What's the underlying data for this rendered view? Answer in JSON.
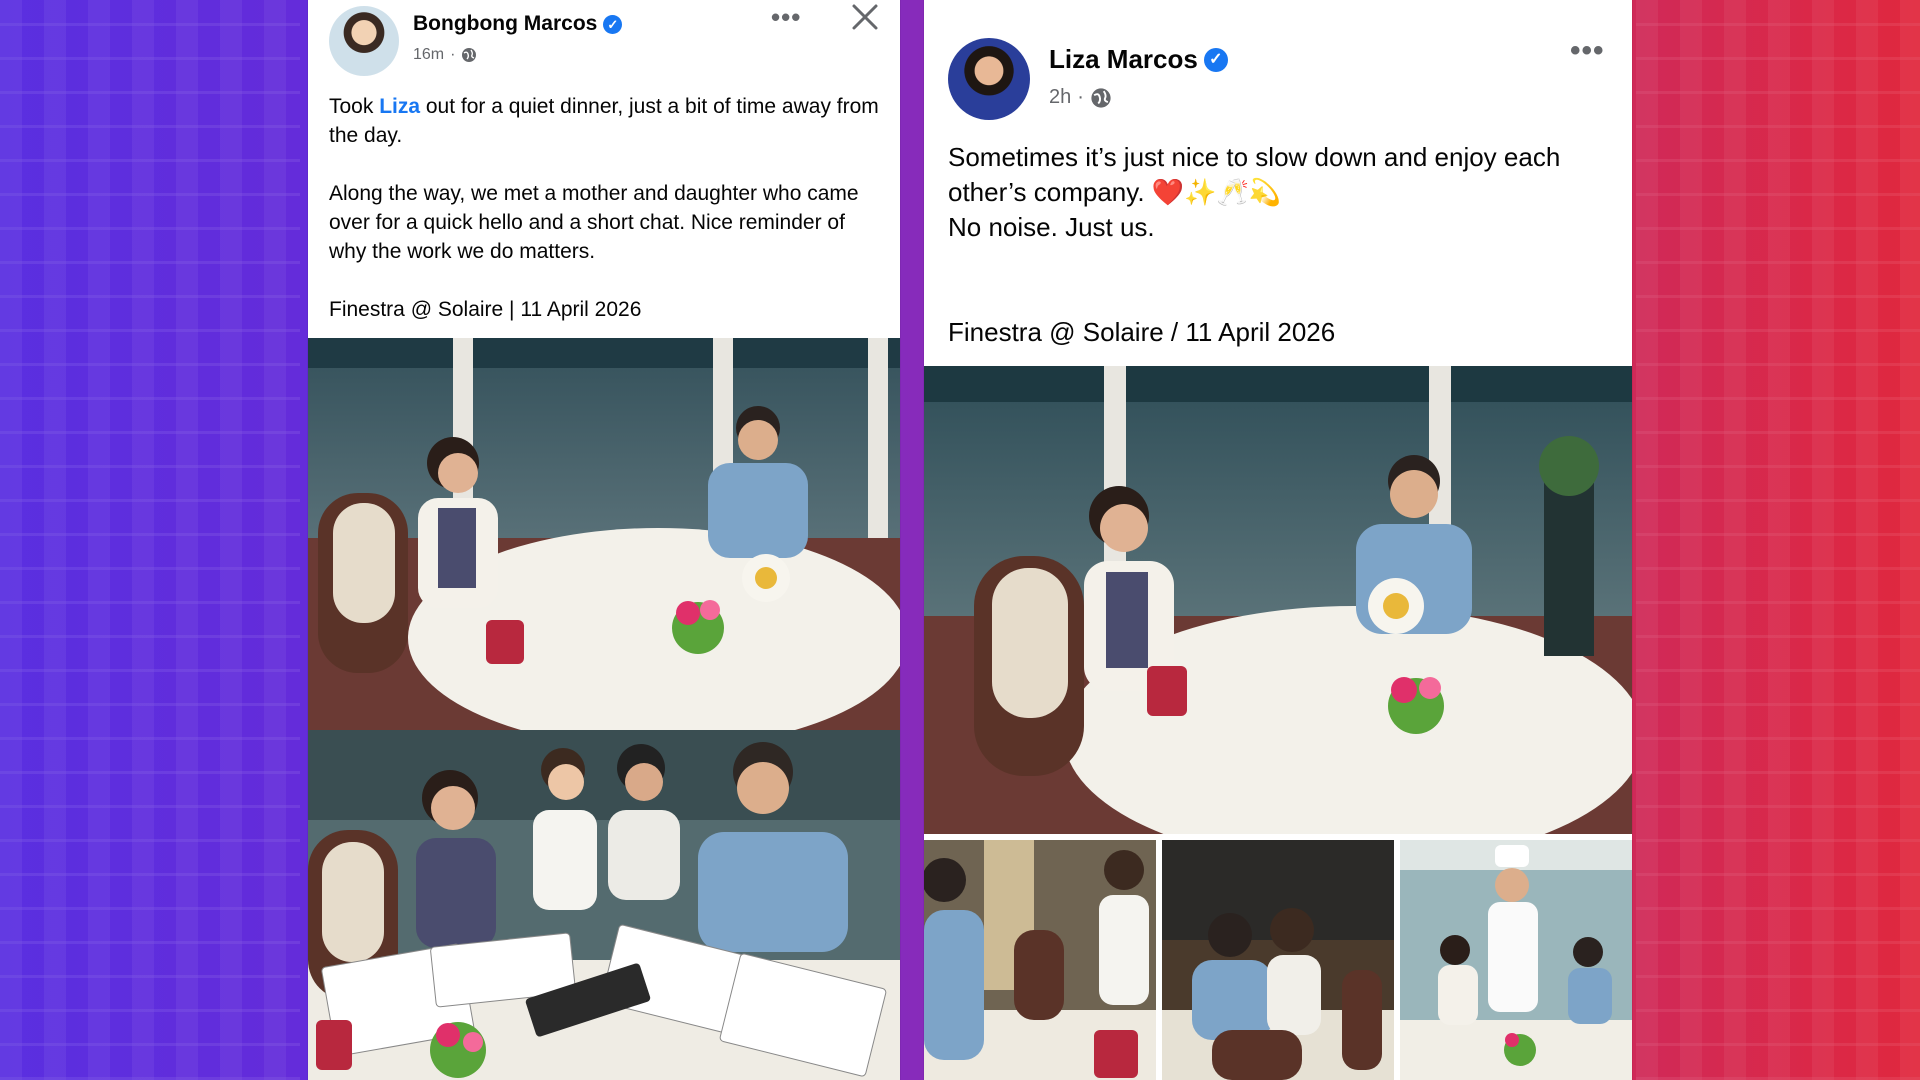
{
  "left_post": {
    "author": "Bongbong Marcos",
    "time": "16m",
    "more_label": "•••",
    "text_before_link": "Took ",
    "link_text": "Liza",
    "text_after_link": " out for a quiet dinner, just a bit of time away from the day.",
    "paragraph2": "Along the way, we met a mother and daughter who came over for a quick hello and a short chat. Nice reminder of why the work we do matters.",
    "location_line": "Finestra @ Solaire | 11 April 2026"
  },
  "right_post": {
    "author": "Liza Marcos",
    "time": "2h",
    "more_label": "•••",
    "line1": "Sometimes it’s just nice to slow down and enjoy each other’s company. ❤️✨🥂💫",
    "line2": "No noise.  Just us.",
    "location_line": "Finestra @ Solaire / 11 April 2026"
  },
  "icons": {
    "verified": "verified-badge-icon",
    "globe": "globe-icon",
    "close": "close-icon",
    "more": "more-options-icon"
  },
  "colors": {
    "link": "#1877f2",
    "verified": "#1877f2",
    "meta": "#65676b",
    "bg_left": "#5a2fe0",
    "bg_right": "#e0283e"
  }
}
